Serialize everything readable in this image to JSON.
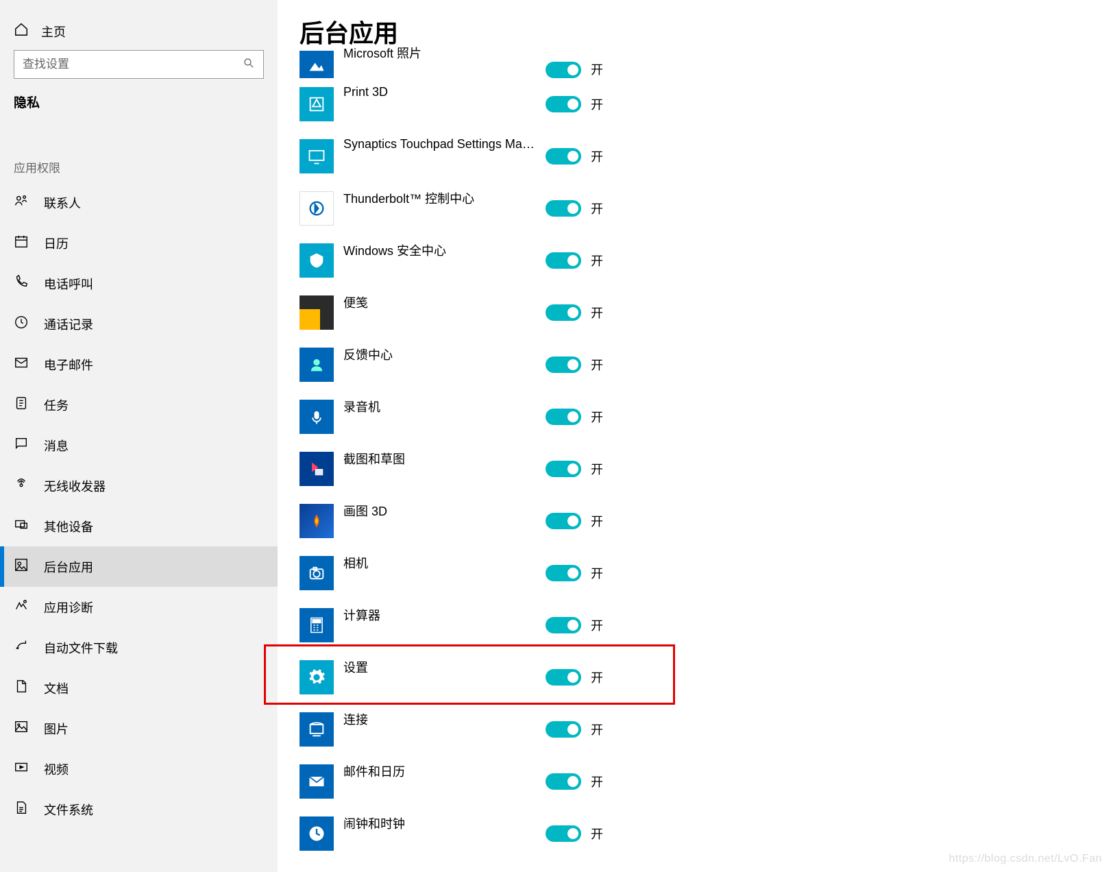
{
  "sidebar": {
    "home_label": "主页",
    "search_placeholder": "查找设置",
    "category_title": "隐私",
    "section_label": "应用权限",
    "items": [
      {
        "label": "联系人"
      },
      {
        "label": "日历"
      },
      {
        "label": "电话呼叫"
      },
      {
        "label": "通话记录"
      },
      {
        "label": "电子邮件"
      },
      {
        "label": "任务"
      },
      {
        "label": "消息"
      },
      {
        "label": "无线收发器"
      },
      {
        "label": "其他设备"
      },
      {
        "label": "后台应用"
      },
      {
        "label": "应用诊断"
      },
      {
        "label": "自动文件下载"
      },
      {
        "label": "文档"
      },
      {
        "label": "图片"
      },
      {
        "label": "视频"
      },
      {
        "label": "文件系统"
      }
    ],
    "active_index": 9
  },
  "main": {
    "title": "后台应用",
    "toggle_on_label": "开",
    "apps": [
      {
        "name": "Microsoft 照片",
        "state": "开",
        "cutoff": true
      },
      {
        "name": "Print 3D",
        "state": "开"
      },
      {
        "name": "Synaptics Touchpad Settings Manag...",
        "state": "开"
      },
      {
        "name": "Thunderbolt™ 控制中心",
        "state": "开"
      },
      {
        "name": "Windows 安全中心",
        "state": "开"
      },
      {
        "name": "便笺",
        "state": "开"
      },
      {
        "name": "反馈中心",
        "state": "开"
      },
      {
        "name": "录音机",
        "state": "开"
      },
      {
        "name": "截图和草图",
        "state": "开"
      },
      {
        "name": "画图 3D",
        "state": "开"
      },
      {
        "name": "相机",
        "state": "开"
      },
      {
        "name": "计算器",
        "state": "开"
      },
      {
        "name": "设置",
        "state": "开",
        "highlight": true
      },
      {
        "name": "连接",
        "state": "开"
      },
      {
        "name": "邮件和日历",
        "state": "开"
      },
      {
        "name": "闹钟和时钟",
        "state": "开"
      }
    ]
  },
  "watermark": "https://blog.csdn.net/LvO.Fan"
}
